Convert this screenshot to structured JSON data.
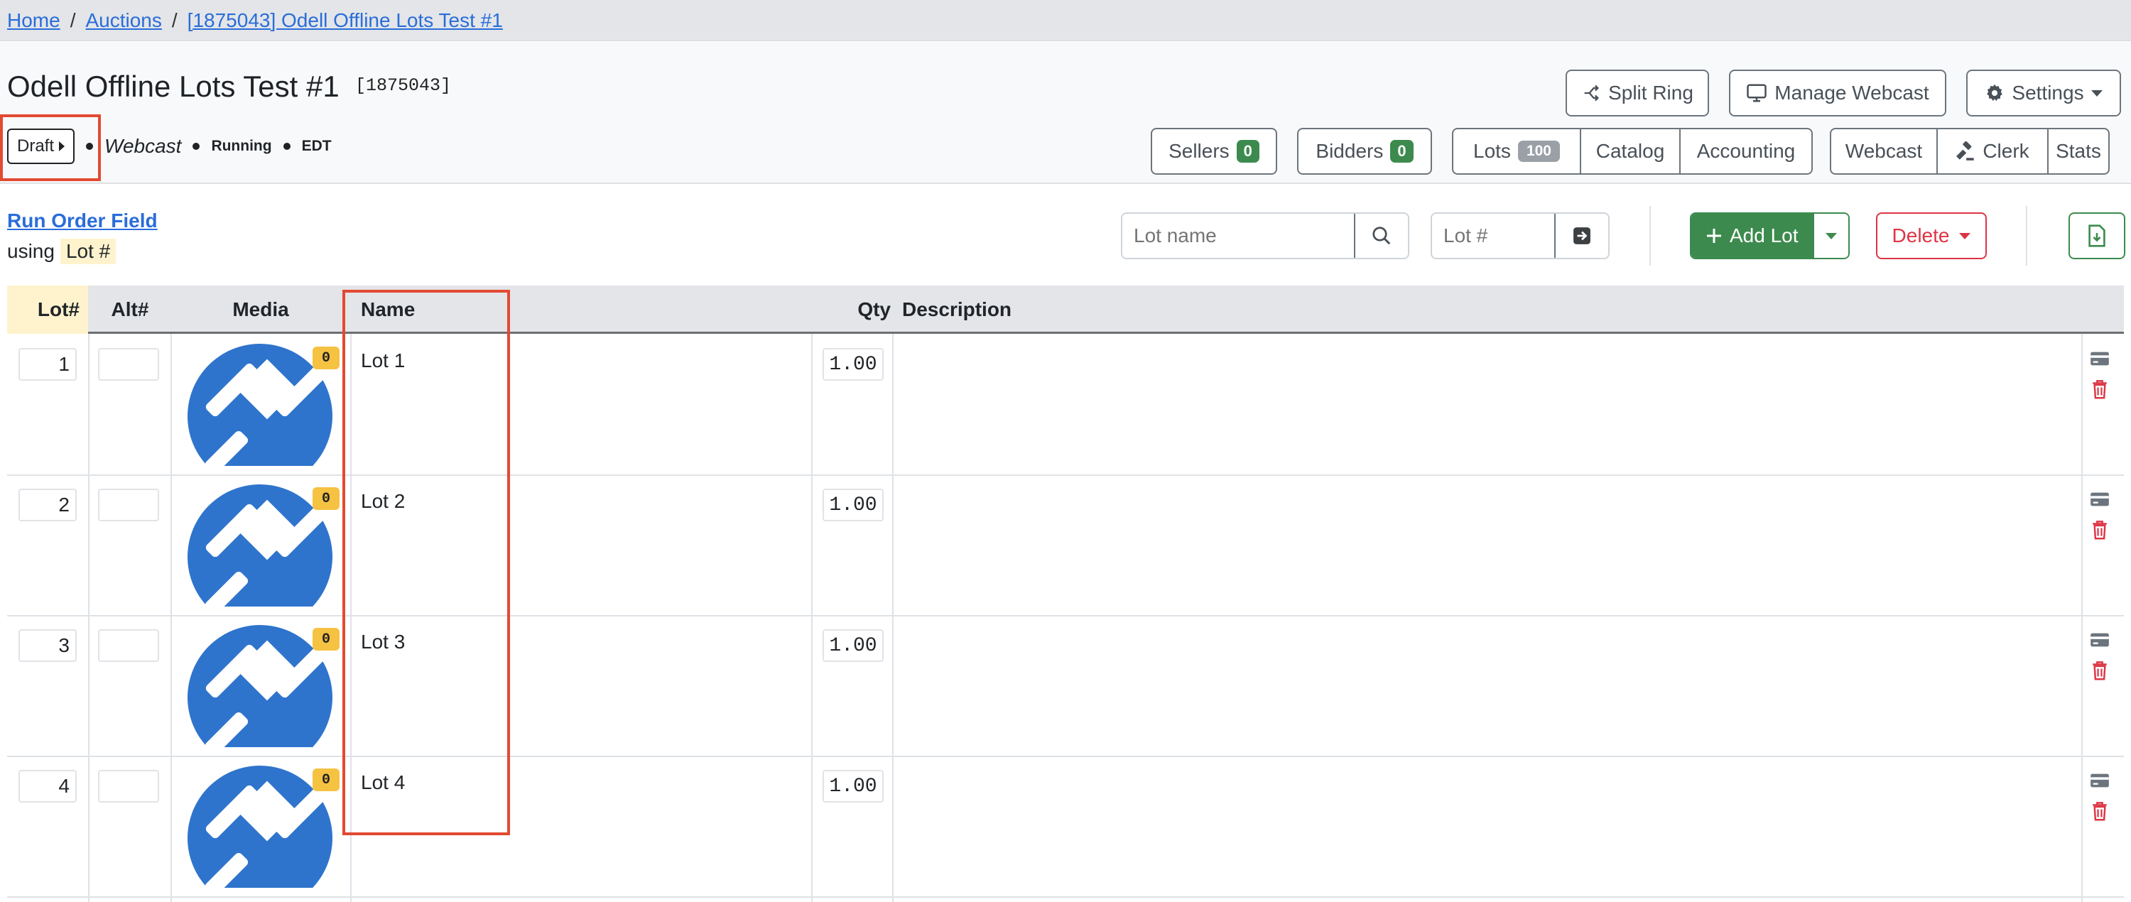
{
  "breadcrumb": {
    "home": "Home",
    "auctions": "Auctions",
    "current": "[1875043] Odell Offline Lots Test #1",
    "separator": "/"
  },
  "header": {
    "title": "Odell Offline Lots Test #1",
    "auction_id": "[1875043]",
    "status": {
      "draft": "Draft",
      "webcast": "Webcast",
      "running": "Running",
      "timezone": "EDT"
    }
  },
  "actions": {
    "split_ring": "Split Ring",
    "manage_webcast": "Manage Webcast",
    "settings": "Settings"
  },
  "nav": {
    "sellers": "Sellers",
    "sellers_count": "0",
    "bidders": "Bidders",
    "bidders_count": "0",
    "lots": "Lots",
    "lots_count": "100",
    "catalog": "Catalog",
    "accounting": "Accounting",
    "webcast": "Webcast",
    "clerk": "Clerk",
    "stats": "Stats"
  },
  "toolbar": {
    "run_order_field": "Run Order Field",
    "using": "using",
    "using_field": "Lot #",
    "lot_name_placeholder": "Lot name",
    "lot_num_placeholder": "Lot #",
    "add_lot": "Add Lot",
    "delete": "Delete"
  },
  "table": {
    "columns": {
      "lot": "Lot#",
      "alt": "Alt#",
      "media": "Media",
      "name": "Name",
      "qty": "Qty",
      "description": "Description"
    },
    "rows": [
      {
        "lot": "1",
        "name": "Lot 1",
        "qty": "1.00",
        "media_count": "0"
      },
      {
        "lot": "2",
        "name": "Lot 2",
        "qty": "1.00",
        "media_count": "0"
      },
      {
        "lot": "3",
        "name": "Lot 3",
        "qty": "1.00",
        "media_count": "0"
      },
      {
        "lot": "4",
        "name": "Lot 4",
        "qty": "1.00",
        "media_count": "0"
      }
    ]
  },
  "colors": {
    "link": "#2a6dd9",
    "success": "#3d8a4e",
    "danger": "#dc3545",
    "highlight": "#e24a32",
    "media_blue": "#2f74cc",
    "badge_yellow": "#f5c242"
  }
}
